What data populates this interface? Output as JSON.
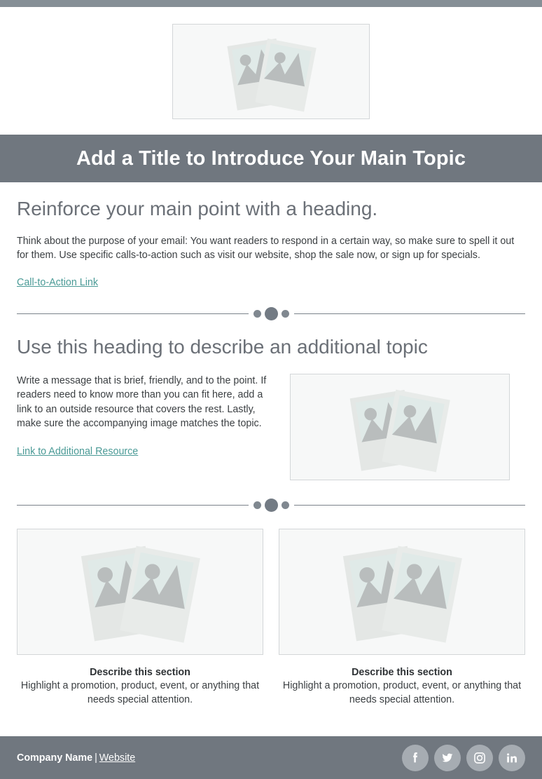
{
  "top_bar": {
    "color": "#868f96"
  },
  "hero": {
    "image_alt": "image-placeholder"
  },
  "title_banner": {
    "title": "Add a Title to Introduce Your Main Topic",
    "background": "#70777f",
    "text_color": "#ffffff"
  },
  "section_one": {
    "heading": "Reinforce your main point with a heading.",
    "body": "Think about the purpose of your email: You want readers to respond in a certain way, so make sure to spell it out for them. Use specific calls-to-action such as visit our website, shop the sale now, or sign up for specials.",
    "link_label": "Call-to-Action Link",
    "link_color": "#4a9a96"
  },
  "section_two": {
    "heading": "Use this heading to describe an additional topic",
    "body": "Write a message that is brief, friendly, and to the point. If readers need to know more than you can fit here, add a link to an outside resource that covers the rest. Lastly, make sure the accompanying image matches the topic.",
    "link_label": "Link to Additional Resource"
  },
  "cards": [
    {
      "title": "Describe this section",
      "text": "Highlight a promotion, product, event, or anything that needs special attention."
    },
    {
      "title": "Describe this section",
      "text": "Highlight a promotion, product, event, or anything that needs special attention."
    }
  ],
  "footer": {
    "company": "Company Name",
    "separator": "|",
    "website_label": "Website",
    "background": "#70777f",
    "socials": [
      {
        "name": "facebook",
        "label": "Facebook"
      },
      {
        "name": "twitter",
        "label": "Twitter"
      },
      {
        "name": "instagram",
        "label": "Instagram"
      },
      {
        "name": "linkedin",
        "label": "LinkedIn"
      }
    ]
  },
  "placeholder": {
    "frame_color": "#e4e7e5",
    "photo_color": "#e0eae8",
    "mountain_color": "#b9bdbd"
  }
}
